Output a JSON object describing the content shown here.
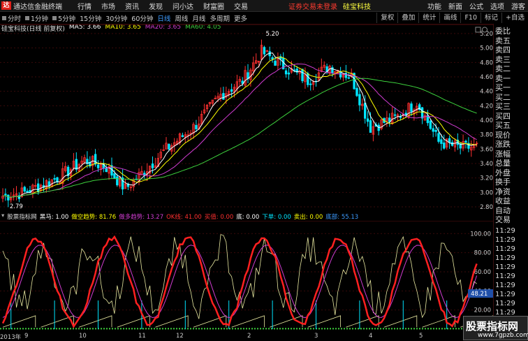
{
  "titlebar": {
    "app_name": "通达信金融终端",
    "menus": [
      "行情",
      "市场",
      "资讯",
      "发现",
      "问小达",
      "财富圈",
      "交易"
    ],
    "warning": "证券交易未登录",
    "stock_name": "硅宝科技",
    "right_menus": [
      "功能",
      "新面",
      "公式",
      "选项",
      "游客"
    ]
  },
  "periodbar": {
    "periods": [
      "分时",
      "1分钟",
      "5分钟",
      "15分钟",
      "30分钟",
      "60分钟",
      "日线",
      "周线",
      "月线",
      "多周期",
      "更多"
    ],
    "active": "日线",
    "tools": [
      "复权",
      "叠加",
      "统计",
      "画线",
      "F10",
      "标记",
      "+自选"
    ]
  },
  "maline": {
    "title": "硅宝科技(日线 前复权)",
    "ma5": "MA5: 3.66",
    "ma10": "MA10: 3.65",
    "ma20": "MA20: 3.65",
    "ma60": "MA60: 4.05"
  },
  "price_axis": [
    "5.20",
    "5.00",
    "4.80",
    "4.60",
    "4.40",
    "4.20",
    "4.00",
    "3.80",
    "3.60",
    "3.40",
    "3.20",
    "3.00",
    "2.80"
  ],
  "price_annotations": {
    "high": "5.20",
    "low": "2.79"
  },
  "indicator": {
    "name": "股票指标网",
    "items": [
      {
        "label": "黑马: 1.00",
        "color": "#ffffff"
      },
      {
        "label": "做空趋势: 81.76",
        "color": "#ffff00"
      },
      {
        "label": "做多趋势: 13.27",
        "color": "#d03cd0"
      },
      {
        "label": "OK线: 41.00",
        "color": "#ff3030"
      },
      {
        "label": "买值: 0.00",
        "color": "#ff3030"
      },
      {
        "label": "底: 0.00",
        "color": "#ffffff"
      },
      {
        "label": "下单: 0.00",
        "color": "#00e5ff"
      },
      {
        "label": "卖出: 0.00",
        "color": "#ffff00"
      },
      {
        "label": "底部: 55.13",
        "color": "#3d9bff"
      }
    ]
  },
  "ind_axis": [
    "100.00",
    "80.00",
    "60.00",
    "40.00",
    "20.00"
  ],
  "ind_current": "48.21",
  "date_labels": [
    "2013年",
    "9",
    "10",
    "11",
    "12",
    "2",
    "3",
    "4",
    "5"
  ],
  "right_panel": [
    "委比",
    "卖五",
    "卖四",
    "卖三",
    "卖二",
    "卖一",
    "买一",
    "买二",
    "买三",
    "买四",
    "买五",
    "现价",
    "涨跌",
    "涨幅",
    "总量",
    "外盘",
    "换手",
    "净资",
    "收益",
    "自动",
    "交易"
  ],
  "right_panel_times": [
    "11:29",
    "11:29",
    "11:29",
    "11:29",
    "11:29",
    "11:29",
    "11:29",
    "11:29",
    "11:29",
    "11:29"
  ],
  "watermark": {
    "title": "股票指标网",
    "url": "www.7gpzb.com"
  },
  "colors": {
    "ma5": "#ffffff",
    "ma10": "#ffff00",
    "ma20": "#d03cd0",
    "ma60": "#3dd13d",
    "up": "#ff3030",
    "down": "#00e5ff",
    "accent": "#3d9bff"
  }
}
